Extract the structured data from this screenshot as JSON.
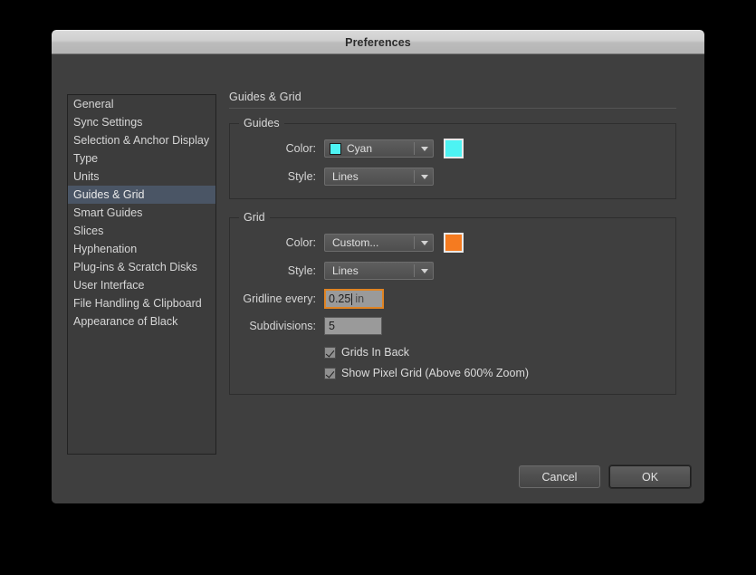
{
  "window": {
    "title": "Preferences"
  },
  "sidebar": {
    "items": [
      {
        "label": "General",
        "selected": false
      },
      {
        "label": "Sync Settings",
        "selected": false
      },
      {
        "label": "Selection & Anchor Display",
        "selected": false
      },
      {
        "label": "Type",
        "selected": false
      },
      {
        "label": "Units",
        "selected": false
      },
      {
        "label": "Guides & Grid",
        "selected": true
      },
      {
        "label": "Smart Guides",
        "selected": false
      },
      {
        "label": "Slices",
        "selected": false
      },
      {
        "label": "Hyphenation",
        "selected": false
      },
      {
        "label": "Plug-ins & Scratch Disks",
        "selected": false
      },
      {
        "label": "User Interface",
        "selected": false
      },
      {
        "label": "File Handling & Clipboard",
        "selected": false
      },
      {
        "label": "Appearance of Black",
        "selected": false
      }
    ]
  },
  "pane": {
    "title": "Guides & Grid"
  },
  "guides": {
    "legend": "Guides",
    "color_label": "Color:",
    "color_value": "Cyan",
    "color_swatch": "#4DF3F3",
    "preview_swatch": "#4DF3F3",
    "style_label": "Style:",
    "style_value": "Lines"
  },
  "grid": {
    "legend": "Grid",
    "color_label": "Color:",
    "color_value": "Custom...",
    "preview_swatch": "#F57B20",
    "style_label": "Style:",
    "style_value": "Lines",
    "gridline_label": "Gridline every:",
    "gridline_value": "0.25",
    "gridline_unit": "in",
    "subdivisions_label": "Subdivisions:",
    "subdivisions_value": "5",
    "grids_in_back_label": "Grids In Back",
    "show_pixel_grid_label": "Show Pixel Grid (Above 600% Zoom)"
  },
  "footer": {
    "cancel_label": "Cancel",
    "ok_label": "OK"
  }
}
